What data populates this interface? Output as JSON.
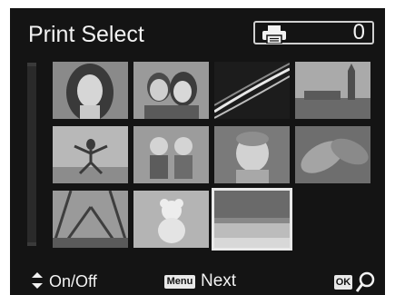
{
  "header": {
    "title": "Print Select",
    "print_count": "0"
  },
  "icons": {
    "printer": "printer-icon",
    "up_down": "up-down-arrows-icon",
    "zoom": "magnifier-icon"
  },
  "thumbnails": [
    {
      "subject": "woman-portrait",
      "selected": false
    },
    {
      "subject": "couple-portrait",
      "selected": false
    },
    {
      "subject": "night-road-light-trails",
      "selected": false
    },
    {
      "subject": "big-ben-skyline",
      "selected": false
    },
    {
      "subject": "jumping-woman",
      "selected": false
    },
    {
      "subject": "two-children",
      "selected": false
    },
    {
      "subject": "toddler",
      "selected": false
    },
    {
      "subject": "leaves-closeup",
      "selected": false
    },
    {
      "subject": "bridge-cables",
      "selected": false
    },
    {
      "subject": "teddy-bear",
      "selected": false
    },
    {
      "subject": "landscape-sea",
      "selected": true
    }
  ],
  "footer": {
    "on_off_label": "On/Off",
    "menu_badge": "Menu",
    "next_label": "Next",
    "ok_badge": "OK"
  }
}
